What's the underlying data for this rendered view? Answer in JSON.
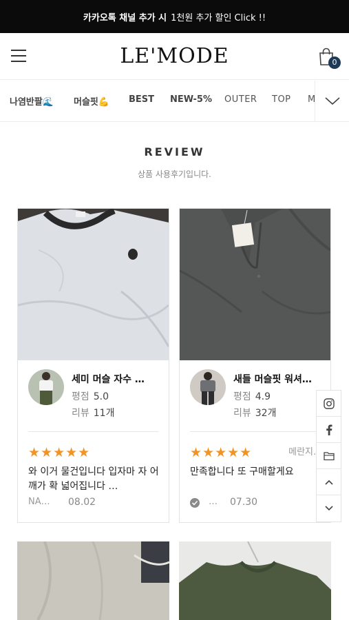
{
  "top_banner": {
    "bold": "카카오톡 채널 추가 시",
    "rest": "1천원 추가 할인 Click !!"
  },
  "header": {
    "logo": "LE'MODE",
    "cart_count": "0"
  },
  "nav": {
    "items": [
      "나염반팔🌊",
      "머슬핏💪",
      "BEST",
      "NEW-5%",
      "OUTER",
      "TOP",
      "M"
    ]
  },
  "review_section": {
    "title": "REVIEW",
    "subtitle": "상품 사용후기입니다."
  },
  "reviews": [
    {
      "name": "세미 머슬 자수 …",
      "rating_label": "평점",
      "rating": "5.0",
      "count_label": "리뷰",
      "count": "11개",
      "stars": "★★★★★",
      "text": "와 이거 물건입니다 입자마 자 어깨가 확 넓어집니다 …",
      "author": "NA…",
      "date": "08.02",
      "option": ""
    },
    {
      "name": "새들 머슬핏 워셔…",
      "rating_label": "평점",
      "rating": "4.9",
      "count_label": "리뷰",
      "count": "32개",
      "stars": "★★★★★",
      "text": "만족합니다 또 구매할게요",
      "author": "…",
      "date": "07.30",
      "option": "메란지…"
    }
  ],
  "side_menu": [
    "instagram-icon",
    "facebook-icon",
    "folder-icon",
    "chevron-up-icon",
    "chevron-down-icon"
  ],
  "colors": {
    "banner": "#0b0b0b",
    "star": "#f39323",
    "badge": "#1d3b57"
  }
}
